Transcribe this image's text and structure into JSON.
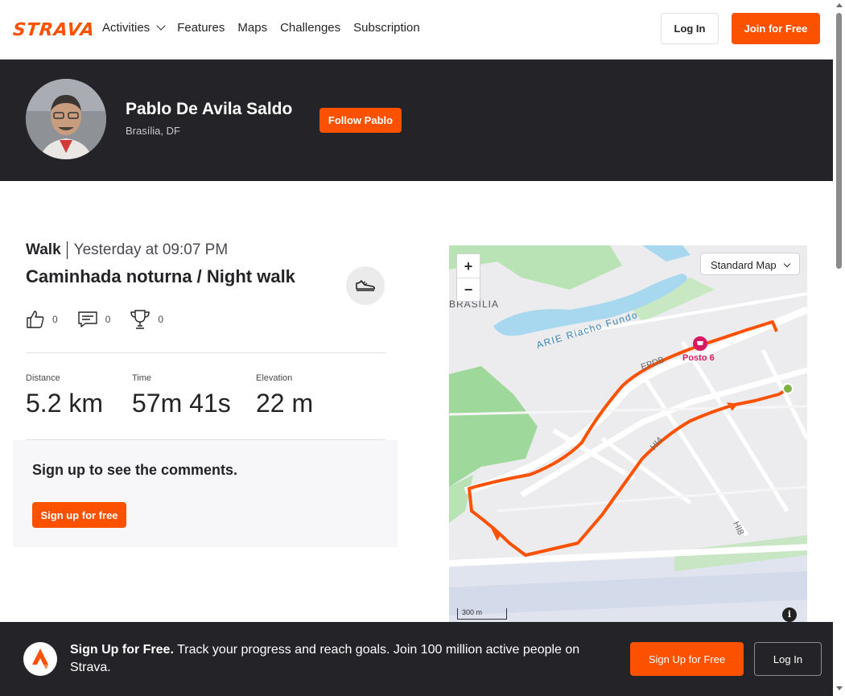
{
  "header": {
    "logo": "STRAVA",
    "nav": [
      "Activities",
      "Features",
      "Maps",
      "Challenges",
      "Subscription"
    ],
    "login_label": "Log In",
    "join_label": "Join for Free"
  },
  "athlete": {
    "name": "Pablo De Avila Saldo",
    "location": "Brasília, DF",
    "follow_label": "Follow Pablo"
  },
  "activity": {
    "type": "Walk",
    "date": "Yesterday at 09:07 PM",
    "title": "Caminhada noturna / Night walk",
    "kudos": "0",
    "comments": "0",
    "achievements": "0",
    "stats": [
      {
        "label": "Distance",
        "value": "5.2 km"
      },
      {
        "label": "Time",
        "value": "57m 41s"
      },
      {
        "label": "Elevation",
        "value": "22 m"
      }
    ]
  },
  "comments": {
    "title": "Sign up to see the comments.",
    "button_label": "Sign up for free"
  },
  "map": {
    "style_label": "Standard Map",
    "zoom_in": "+",
    "zoom_out": "−",
    "scale_label": "300 m",
    "info": "i",
    "labels": {
      "riacho": "ARIE Riacho Fundo",
      "brasilia": "BRASÍLIA",
      "epdb": "EPDB",
      "hi4": "HI4",
      "hi8": "HI8",
      "poi": "Posto 6"
    },
    "route_color": "#fc5200",
    "water_color": "#a8d8ef",
    "park_color": "#9ed89a"
  },
  "banner": {
    "headline": "Sign Up for Free.",
    "text": "Track your progress and reach goals. Join 100 million active people on Strava.",
    "signup_label": "Sign Up for Free",
    "login_label": "Log In"
  }
}
